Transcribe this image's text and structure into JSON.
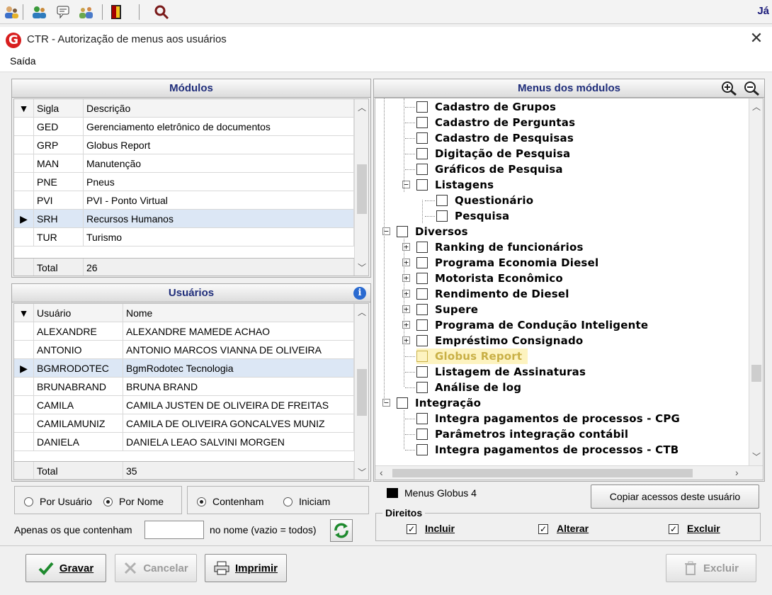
{
  "toolbar": {
    "icons": [
      "users-icon",
      "user-group-icon",
      "chat-icon",
      "people-icon",
      "exit-door-icon",
      "search-icon"
    ],
    "user_label": "Já"
  },
  "window": {
    "title": "CTR - Autorização de menus aos usuários",
    "logo_letter": "G",
    "close_symbol": "✕",
    "menu": [
      "Saída"
    ]
  },
  "modulos": {
    "header": "Módulos",
    "columns": [
      "Sigla",
      "Descrição"
    ],
    "rows": [
      {
        "sigla": "GED",
        "descricao": "Gerenciamento eletrônico de documentos"
      },
      {
        "sigla": "GRP",
        "descricao": "Globus Report"
      },
      {
        "sigla": "MAN",
        "descricao": "Manutenção"
      },
      {
        "sigla": "PNE",
        "descricao": "Pneus"
      },
      {
        "sigla": "PVI",
        "descricao": "PVI - Ponto Virtual"
      },
      {
        "sigla": "SRH",
        "descricao": "Recursos Humanos"
      },
      {
        "sigla": "TUR",
        "descricao": "Turismo"
      }
    ],
    "selected_index": 5,
    "total_label": "Total",
    "total_value": "26"
  },
  "usuarios": {
    "header": "Usuários",
    "columns": [
      "Usuário",
      "Nome"
    ],
    "rows": [
      {
        "usuario": "ALEXANDRE",
        "nome": "ALEXANDRE MAMEDE ACHAO"
      },
      {
        "usuario": "ANTONIO",
        "nome": "ANTONIO MARCOS VIANNA DE OLIVEIRA"
      },
      {
        "usuario": "BGMRODOTEC",
        "nome": "BgmRodotec Tecnologia"
      },
      {
        "usuario": "BRUNABRAND",
        "nome": "BRUNA BRAND"
      },
      {
        "usuario": "CAMILA",
        "nome": "CAMILA JUSTEN DE OLIVEIRA DE FREITAS"
      },
      {
        "usuario": "CAMILAMUNIZ",
        "nome": "CAMILA DE OLIVEIRA GONCALVES MUNIZ"
      },
      {
        "usuario": "DANIELA",
        "nome": "DANIELA LEAO SALVINI MORGEN"
      }
    ],
    "selected_index": 2,
    "total_label": "Total",
    "total_value": "35"
  },
  "menus": {
    "header": "Menus dos módulos",
    "tree": [
      {
        "label": "Cadastro de Grupos",
        "level": 2,
        "expander": ""
      },
      {
        "label": "Cadastro de Perguntas",
        "level": 2,
        "expander": ""
      },
      {
        "label": "Cadastro de Pesquisas",
        "level": 2,
        "expander": ""
      },
      {
        "label": "Digitação de Pesquisa",
        "level": 2,
        "expander": ""
      },
      {
        "label": "Gráficos de Pesquisa",
        "level": 2,
        "expander": ""
      },
      {
        "label": "Listagens",
        "level": 2,
        "expander": "-"
      },
      {
        "label": "Questionário",
        "level": 3,
        "expander": ""
      },
      {
        "label": "Pesquisa",
        "level": 3,
        "expander": ""
      },
      {
        "label": "Diversos",
        "level": 1,
        "expander": "-"
      },
      {
        "label": "Ranking de funcionários",
        "level": 2,
        "expander": "+"
      },
      {
        "label": "Programa Economia Diesel",
        "level": 2,
        "expander": "+"
      },
      {
        "label": "Motorista Econômico",
        "level": 2,
        "expander": "+"
      },
      {
        "label": "Rendimento de Diesel",
        "level": 2,
        "expander": "+"
      },
      {
        "label": "Supere",
        "level": 2,
        "expander": "+"
      },
      {
        "label": "Programa de Condução Inteligente",
        "level": 2,
        "expander": "+"
      },
      {
        "label": "Empréstimo Consignado",
        "level": 2,
        "expander": "+"
      },
      {
        "label": "Globus Report",
        "level": 2,
        "expander": "",
        "highlighted": true
      },
      {
        "label": "Listagem de Assinaturas",
        "level": 2,
        "expander": ""
      },
      {
        "label": "Análise de log",
        "level": 2,
        "expander": ""
      },
      {
        "label": "Integração",
        "level": 1,
        "expander": "-"
      },
      {
        "label": "Integra pagamentos de processos - CPG",
        "level": 2,
        "expander": ""
      },
      {
        "label": "Parâmetros integração contábil",
        "level": 2,
        "expander": ""
      },
      {
        "label": "Integra pagamentos de processos - CTB",
        "level": 2,
        "expander": ""
      }
    ],
    "legend_label": "Menus Globus 4",
    "copy_button": "Copiar acessos deste usuário"
  },
  "filter": {
    "radio_sort": [
      {
        "label": "Por Usuário",
        "checked": false
      },
      {
        "label": "Por Nome",
        "checked": true
      }
    ],
    "radio_match": [
      {
        "label": "Contenham",
        "checked": true
      },
      {
        "label": "Iniciam",
        "checked": false
      }
    ],
    "contains_label": "Apenas os que contenham",
    "contains_value": "",
    "suffix_label": "no nome (vazio = todos)"
  },
  "direitos": {
    "title": "Direitos",
    "items": [
      {
        "label": "Incluir",
        "checked": true
      },
      {
        "label": "Alterar",
        "checked": true
      },
      {
        "label": "Excluir",
        "checked": true
      }
    ]
  },
  "actions": {
    "gravar": "Gravar",
    "cancelar": "Cancelar",
    "imprimir": "Imprimir",
    "excluir": "Excluir"
  }
}
